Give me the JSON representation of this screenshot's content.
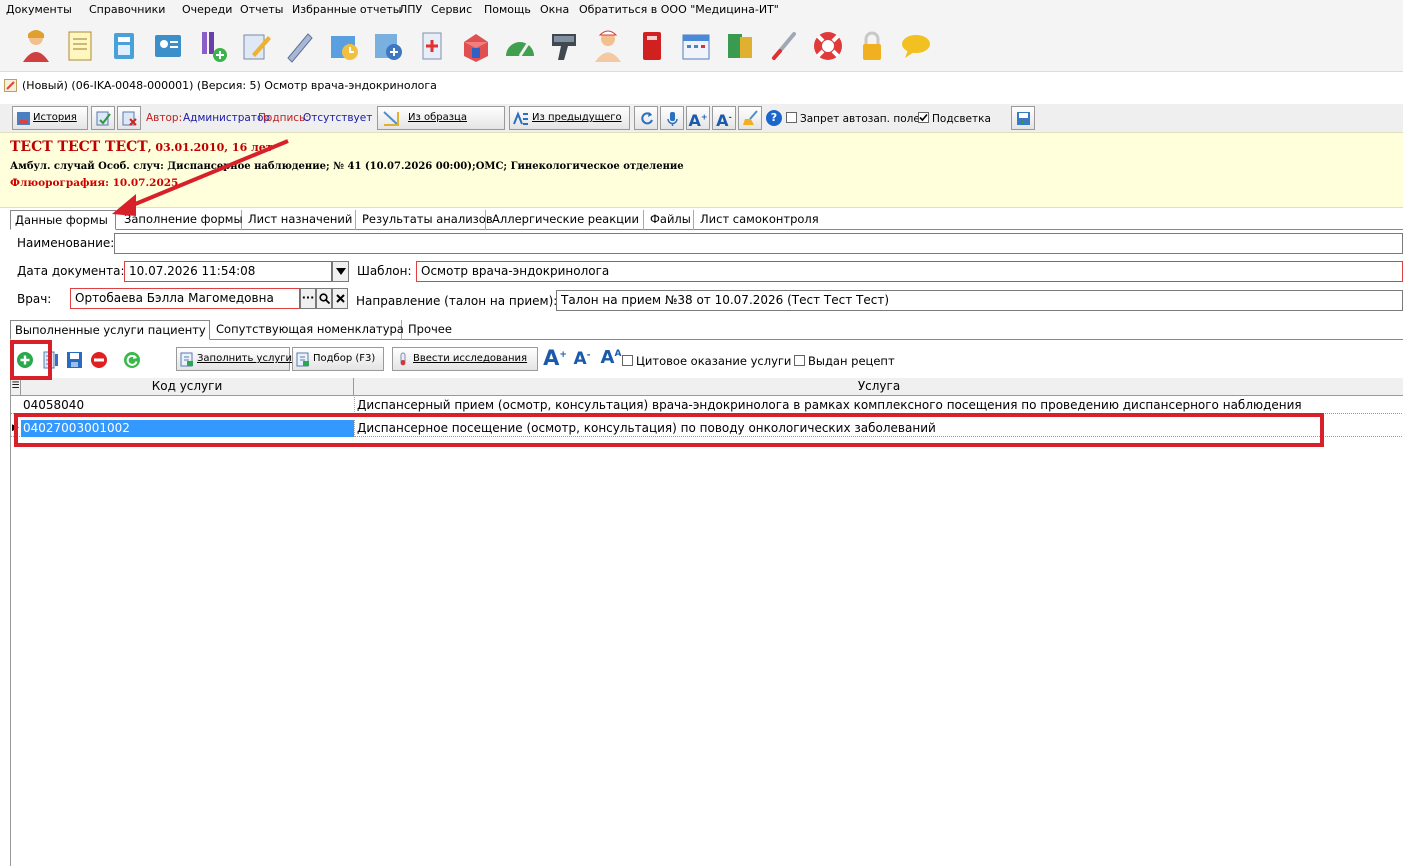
{
  "menu": [
    "Документы",
    "Справочники",
    "Очереди",
    "Отчеты",
    "Избранные отчеты",
    "ЛПУ",
    "Сервис",
    "Помощь",
    "Окна",
    "Обратиться в ООО \"Медицина-ИТ\""
  ],
  "window_title": "(Новый) (06-IKA-0048-000001) (Версия: 5) Осмотр врача-эндокринолога",
  "toolbar": {
    "history": "История",
    "author_label": "Автор:",
    "author_value": "Администратор",
    "signature_label": "Подпись:",
    "signature_value": "Отсутствует",
    "from_sample": "Из образца",
    "from_previous": "Из предыдущего",
    "autofill_ban": "Запрет автозап. полей",
    "highlight": "Подсветка",
    "highlight_checked": true,
    "autofill_ban_checked": false
  },
  "patient": {
    "name": "ТЕСТ ТЕСТ ТЕСТ",
    "dob_age": ", 03.01.2010, 16 лет",
    "case_line": "Амбул. случай Особ. случ: Диспансерное наблюдение;  № 41 (10.07.2026 00:00);ОМС; Гинекологическое отделение",
    "fluoro": "Флюорография: 10.07.2025"
  },
  "form_tabs": [
    "Данные формы",
    "Заполнение формы",
    "Лист назначений",
    "Результаты анализов",
    "Аллергические реакции",
    "Файлы",
    "Лист самоконтроля"
  ],
  "fields": {
    "name_label": "Наименование:",
    "name_value": "",
    "date_label": "Дата документа:",
    "date_value": "10.07.2026 11:54:08",
    "template_label": "Шаблон:",
    "template_value": "Осмотр врача-эндокринолога",
    "doctor_label": "Врач:",
    "doctor_value": "Ортобаева Бэлла Магомедовна",
    "referral_label": "Направление (талон на прием):",
    "referral_value": "Талон на прием №38 от 10.07.2026 (Тест Тест Тест)"
  },
  "service_tabs": [
    "Выполненные услуги пациенту",
    "Сопутствующая номенклатура",
    "Прочее"
  ],
  "services_toolbar": {
    "fill_services": "Заполнить услуги",
    "selection": "Подбор (F3)",
    "enter_studies": "Ввести исследования",
    "cito": "Цитовое оказание услуги",
    "prescription": "Выдан рецепт"
  },
  "grid": {
    "columns": [
      "Код услуги",
      "Услуга"
    ],
    "rows": [
      {
        "code": "04058040",
        "service": "Диспансерный прием (осмотр, консультация) врача-эндокринолога в рамках комплексного посещения по проведению диспансерного наблюдения"
      },
      {
        "code": "04027003001002",
        "service": "Диспансерное посещение (осмотр, консультация) по поводу онкологических заболеваний"
      }
    ]
  },
  "colors": {
    "accent_red": "#d8202a",
    "selection_blue": "#3399ff",
    "link_blue": "#1a1aa6",
    "patient_bg": "#ffffdc"
  }
}
